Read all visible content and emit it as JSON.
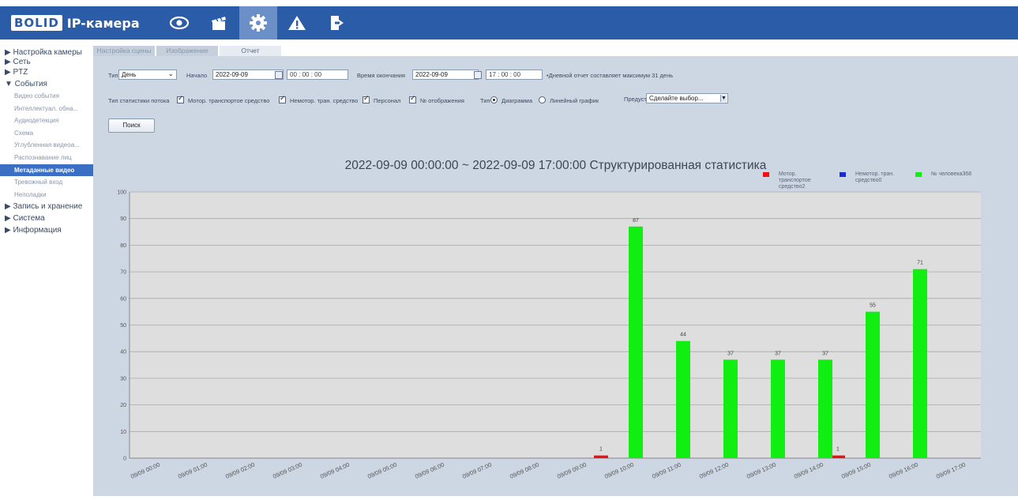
{
  "header": {
    "logo_text": "BOLID",
    "title": "IP-камера",
    "nav_icons": [
      "eye-icon",
      "clapperboard-icon",
      "gear-icon",
      "warning-icon",
      "exit-icon"
    ],
    "active_nav": "gear-icon"
  },
  "sidebar": {
    "items": [
      {
        "label": "▶ Настройка камеры",
        "level": "main"
      },
      {
        "label": "▶ Сеть",
        "level": "main"
      },
      {
        "label": "▶ PTZ",
        "level": "main"
      },
      {
        "label": "▼ События",
        "level": "main"
      },
      {
        "label": "Видео события",
        "level": "sub"
      },
      {
        "label": "Интеллектуал. обна...",
        "level": "sub"
      },
      {
        "label": "Аудиодетекция",
        "level": "sub"
      },
      {
        "label": "Схема",
        "level": "sub"
      },
      {
        "label": "Углубленная видеоа...",
        "level": "sub"
      },
      {
        "label": "Распознавание лиц",
        "level": "sub"
      },
      {
        "label": "Метаданные видео",
        "level": "sub",
        "active": true
      },
      {
        "label": "Тревожный вход",
        "level": "sub"
      },
      {
        "label": "Неполадки",
        "level": "sub"
      },
      {
        "label": "▶ Запись и хранение",
        "level": "main"
      },
      {
        "label": "▶ Система",
        "level": "main"
      },
      {
        "label": "▶ Информация",
        "level": "main"
      }
    ]
  },
  "tabs": [
    {
      "label": "Настройка сцены",
      "active": false
    },
    {
      "label": "Изображение",
      "active": false
    },
    {
      "label": "Отчет",
      "active": true
    }
  ],
  "form": {
    "type_label": "Тип",
    "type_value": "День",
    "start_label": "Начало",
    "start_date": "2022-09-09",
    "start_time": "00 :  00 :  00",
    "end_label": "Время окончания",
    "end_date": "2022-09-09",
    "end_time": "17 :  00 :  00",
    "note": "•Дневной отчет составляет максимум 31 день",
    "flow_label": "Тип статистики потока",
    "cb_motor": "Мотор. транспортое средство",
    "cb_nonmotor": "Немотор. тран. средство",
    "cb_person": "Персонал",
    "cb_display": "№ отображения",
    "chart_type_label": "Тип",
    "radio_bar": "Диаграмма",
    "radio_line": "Линейный график",
    "preset_label": "Предуст",
    "preset_value": "Сделайте выбор...",
    "search_button": "Поиск"
  },
  "colors": {
    "motor": "#ee1111",
    "nonmotor": "#1a2ad8",
    "person": "#11ee11"
  },
  "chart_data": {
    "type": "bar",
    "title": "2022-09-09 00:00:00 ~ 2022-09-09 17:00:00 Структурированная статистика",
    "ylim": [
      0,
      100
    ],
    "yticks": [
      0,
      10,
      20,
      30,
      40,
      50,
      60,
      70,
      80,
      90,
      100
    ],
    "categories": [
      "09/09 00:00",
      "09/09 01:00",
      "09/09 02:00",
      "09/09 03:00",
      "09/09 04:00",
      "09/09 05:00",
      "09/09 06:00",
      "09/09 07:00",
      "09/09 08:00",
      "09/09 09:00",
      "09/09 10:00",
      "09/09 11:00",
      "09/09 12:00",
      "09/09 13:00",
      "09/09 14:00",
      "09/09 15:00",
      "09/09 16:00",
      "09/09 17:00"
    ],
    "series": [
      {
        "name": "Мотор. транспортое средство2",
        "color": "#ee1111",
        "values": [
          0,
          0,
          0,
          0,
          0,
          0,
          0,
          0,
          0,
          0,
          1,
          0,
          0,
          0,
          0,
          1,
          0,
          0
        ]
      },
      {
        "name": "Немотор. тран. средство0",
        "color": "#1a2ad8",
        "values": [
          0,
          0,
          0,
          0,
          0,
          0,
          0,
          0,
          0,
          0,
          0,
          0,
          0,
          0,
          0,
          0,
          0,
          0
        ]
      },
      {
        "name": "№ человека368",
        "color": "#11ee11",
        "values": [
          0,
          0,
          0,
          0,
          0,
          0,
          0,
          0,
          0,
          0,
          87,
          44,
          37,
          37,
          37,
          55,
          71,
          0
        ]
      }
    ],
    "legend_position": "top-right",
    "grid": true
  }
}
